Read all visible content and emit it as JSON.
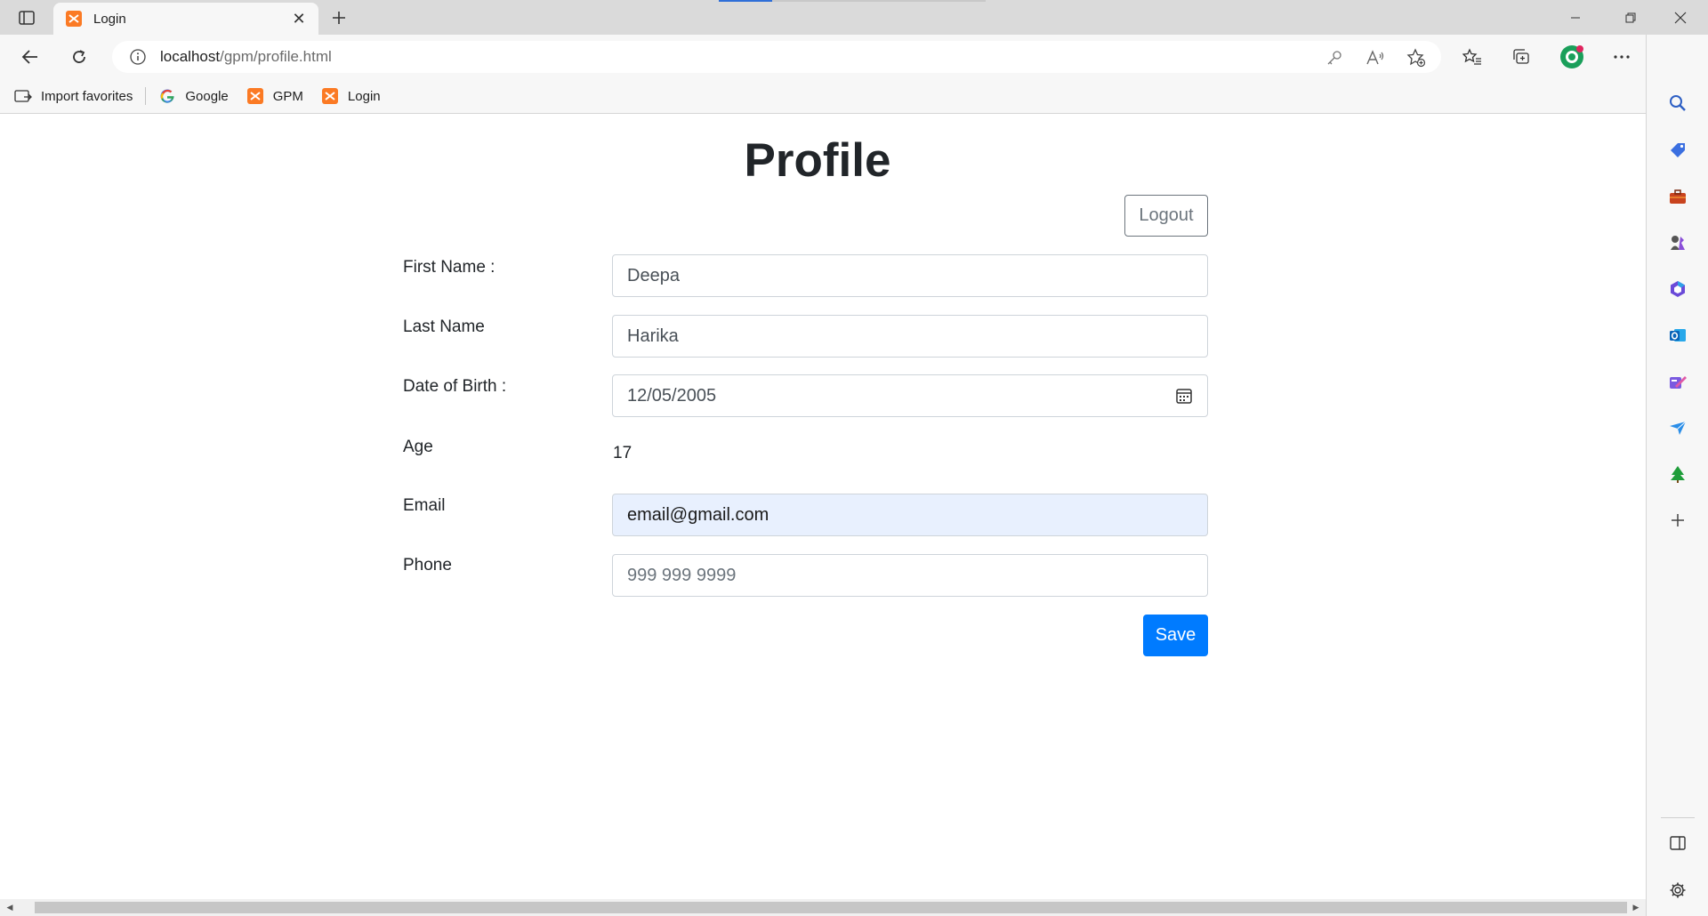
{
  "browser": {
    "tab": {
      "title": "Login"
    },
    "address": {
      "host": "localhost",
      "path": "/gpm/profile.html"
    },
    "favorites": [
      {
        "label": "Import favorites",
        "icon": "import-icon"
      },
      {
        "label": "Google",
        "icon": "google-icon"
      },
      {
        "label": "GPM",
        "icon": "xampp-icon"
      },
      {
        "label": "Login",
        "icon": "xampp-icon"
      }
    ]
  },
  "profile": {
    "title": "Profile",
    "logout_label": "Logout",
    "fields": {
      "first_name": {
        "label": "First Name :",
        "value": "Deepa"
      },
      "last_name": {
        "label": "Last Name",
        "value": "Harika"
      },
      "dob": {
        "label": "Date of Birth :",
        "value": "12/05/2005"
      },
      "age": {
        "label": "Age",
        "value": "17"
      },
      "email": {
        "label": "Email",
        "value": "email@gmail.com"
      },
      "phone": {
        "label": "Phone",
        "placeholder": "999 999 9999"
      }
    },
    "save_label": "Save"
  },
  "colors": {
    "primary": "#007bff",
    "secondary": "#6c757d",
    "autofill": "#e8f0fe",
    "xampp": "#fb7a24"
  }
}
